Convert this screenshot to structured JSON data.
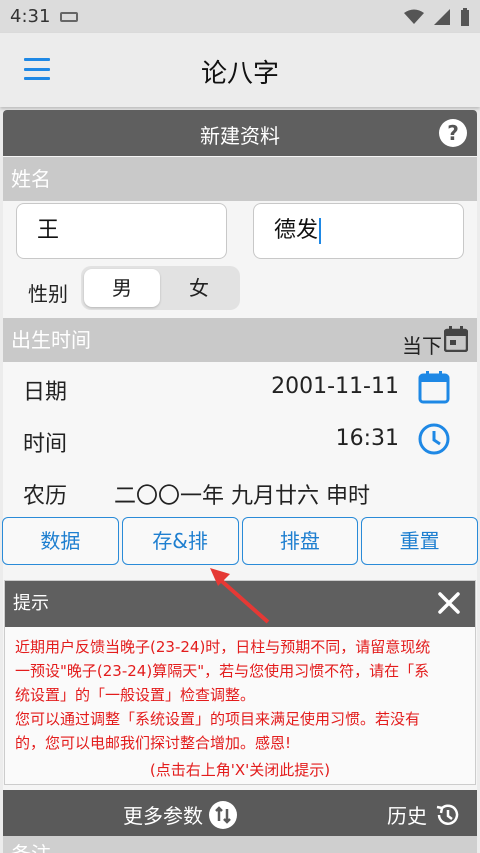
{
  "status": {
    "time": "4:31"
  },
  "app": {
    "title": "论八字"
  },
  "form": {
    "header": "新建资料",
    "name_section": "姓名",
    "surname": "王",
    "given_name": "德发",
    "gender_label": "性别",
    "gender_options": [
      "男",
      "女"
    ],
    "birth_section": "出生时间",
    "now_label": "当下",
    "date_label": "日期",
    "date_value": "2001-11-11",
    "time_label": "时间",
    "time_value": "16:31",
    "lunar_label": "农历",
    "lunar_value": "二〇〇一年 九月廿六 申时"
  },
  "buttons": [
    "数据",
    "存&排",
    "排盘",
    "重置"
  ],
  "tip": {
    "title": "提示",
    "lines": [
      "近期用户反馈当晚子(23-24)时，日柱与预期不同，请留意现统",
      "一预设\"晚子(23-24)算隔天\"，若与您使用习惯不符，请在「系",
      "统设置」的「一般设置」检查调整。",
      "您可以通过调整「系统设置」的项目来满足使用习惯。若没有",
      "的，您可以电邮我们探讨整合增加。感恩!"
    ],
    "footer": "(点击右上角'X'关闭此提示)"
  },
  "more": {
    "params_label": "更多参数",
    "history_label": "历史"
  },
  "memo_label": "备注",
  "colors": {
    "accent": "#1e88e5",
    "dark_header": "#5f5f5f",
    "tip_text": "#e31c1c",
    "arrow": "#e53935"
  }
}
